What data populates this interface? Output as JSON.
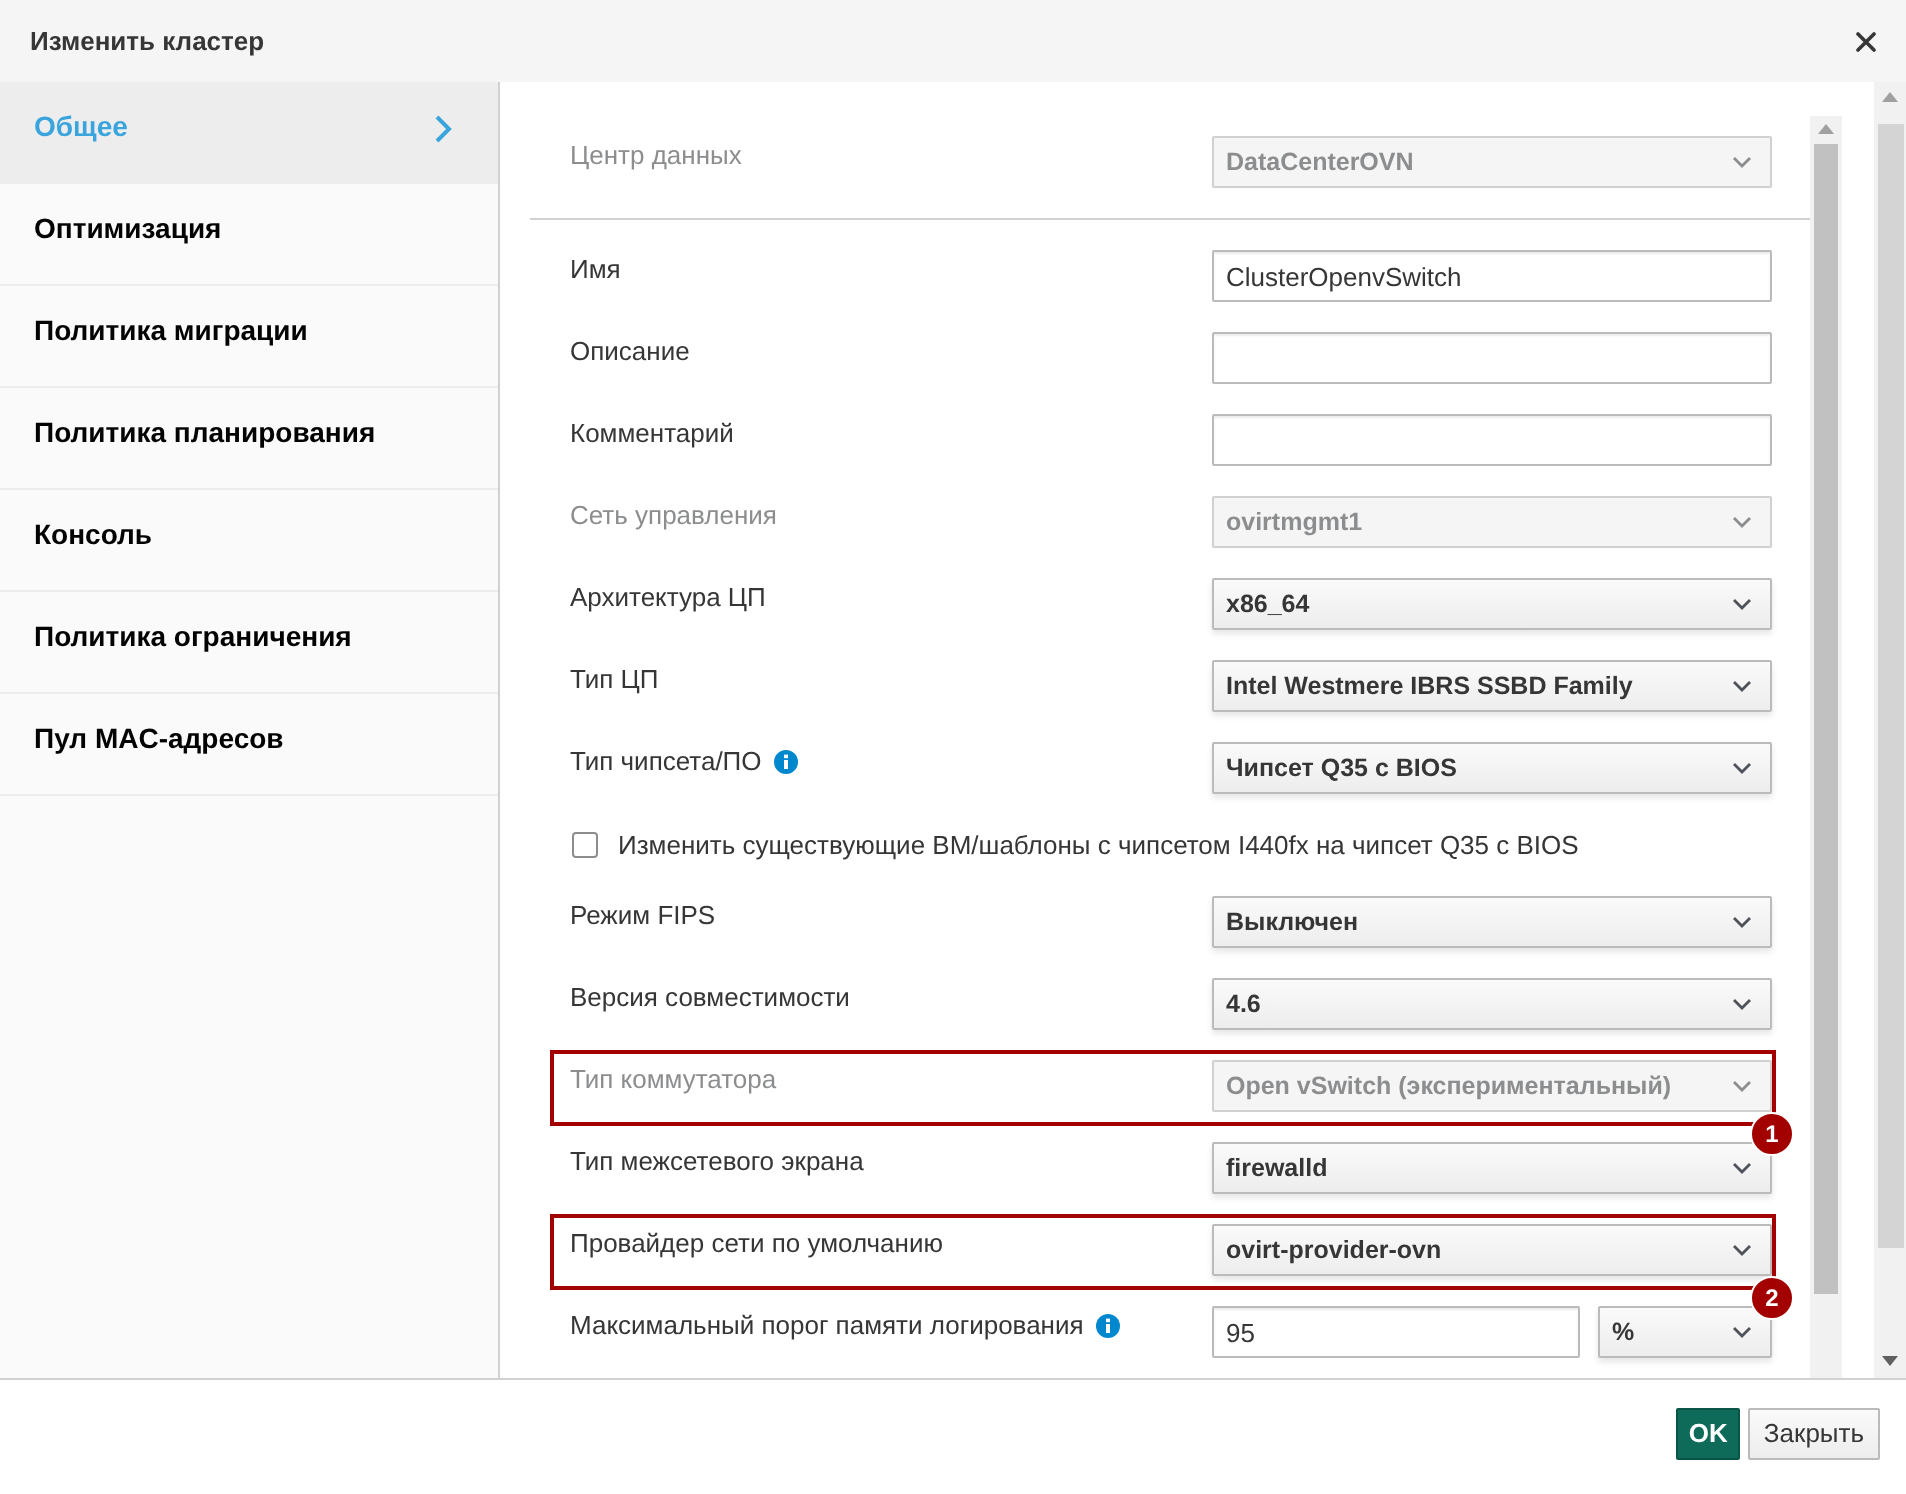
{
  "dialog": {
    "title": "Изменить кластер"
  },
  "sidebar": {
    "items": [
      {
        "label": "Общее",
        "selected": true
      },
      {
        "label": "Оптимизация",
        "selected": false
      },
      {
        "label": "Политика миграции",
        "selected": false
      },
      {
        "label": "Политика планирования",
        "selected": false
      },
      {
        "label": "Консоль",
        "selected": false
      },
      {
        "label": "Политика ограничения",
        "selected": false
      },
      {
        "label": "Пул MAC-адресов",
        "selected": false
      }
    ]
  },
  "form": {
    "header_fields": [
      {
        "kind": "select",
        "label": "Центр данных",
        "value": "DataCenterOVN",
        "disabled": true,
        "info": false
      }
    ],
    "fields": [
      {
        "kind": "text",
        "label": "Имя",
        "value": "ClusterOpenvSwitch",
        "disabled": false,
        "info": false
      },
      {
        "kind": "text",
        "label": "Описание",
        "disabled": false,
        "info": false
      },
      {
        "kind": "text",
        "label": "Комментарий",
        "disabled": false,
        "info": false
      },
      {
        "kind": "select",
        "label": "Сеть управления",
        "value": "ovirtmgmt1",
        "disabled": true,
        "info": false
      },
      {
        "kind": "select",
        "label": "Архитектура ЦП",
        "value": "x86_64",
        "disabled": false,
        "info": false
      },
      {
        "kind": "select",
        "label": "Тип ЦП",
        "value": "Intel Westmere IBRS SSBD Family",
        "disabled": false,
        "info": false
      },
      {
        "kind": "select",
        "label": "Тип чипсета/ПО",
        "value": "Чипсет Q35 с BIOS",
        "disabled": false,
        "info": true
      },
      {
        "kind": "checkbox",
        "label": "Изменить существующие ВМ/шаблоны с чипсетом I440fx на чипсет Q35 с BIOS",
        "checked": false
      },
      {
        "kind": "select",
        "label": "Режим FIPS",
        "value": "Выключен",
        "disabled": false,
        "info": false
      },
      {
        "kind": "select",
        "label": "Версия совместимости",
        "value": "4.6",
        "disabled": false,
        "info": false
      },
      {
        "kind": "select",
        "label": "Тип коммутатора",
        "value": "Open vSwitch (экспериментальный)",
        "disabled": true,
        "info": false,
        "callout": "1"
      },
      {
        "kind": "select",
        "label": "Тип межсетевого экрана",
        "value": "firewalld",
        "disabled": false,
        "info": false
      },
      {
        "kind": "select",
        "label": "Провайдер сети по умолчанию",
        "value": "ovirt-provider-ovn",
        "disabled": false,
        "info": false,
        "callout": "2"
      },
      {
        "kind": "number_unit",
        "label": "Максимальный порог памяти логирования",
        "value": "95",
        "unit": "%",
        "disabled": false,
        "info": true
      }
    ]
  },
  "footer": {
    "buttons": [
      {
        "label": "OK",
        "kind": "primary"
      },
      {
        "label": "Закрыть",
        "kind": "default"
      }
    ]
  }
}
